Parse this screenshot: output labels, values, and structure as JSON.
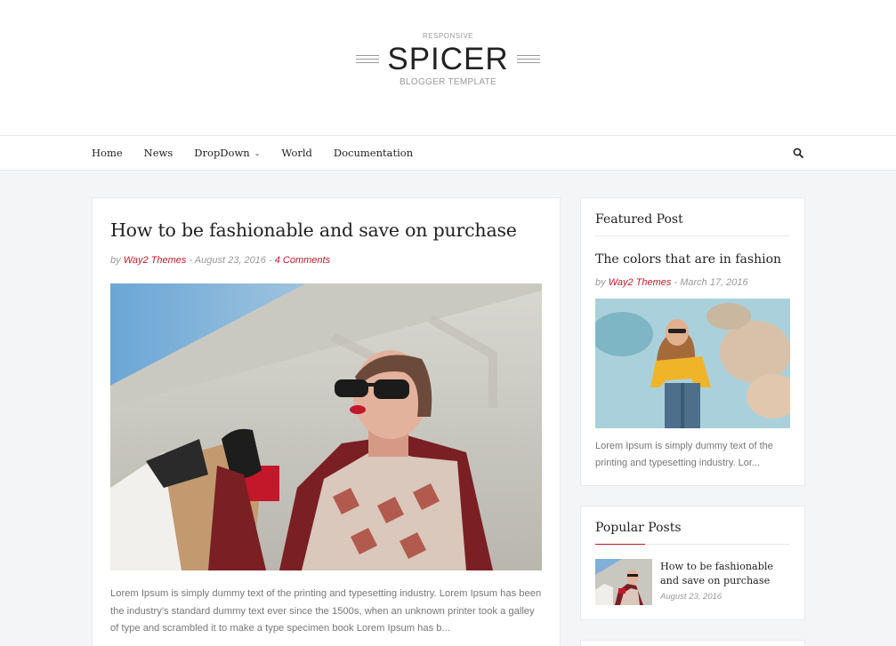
{
  "header": {
    "logo_tag": "RESPONSIVE",
    "logo_main": "SPICER",
    "logo_sub": "BLOGGER TEMPLATE"
  },
  "nav": {
    "items": [
      {
        "label": "Home"
      },
      {
        "label": "News"
      },
      {
        "label": "DropDown"
      },
      {
        "label": "World"
      },
      {
        "label": "Documentation"
      }
    ],
    "search_icon": "search-icon"
  },
  "post": {
    "title": "How to be fashionable and save on purchase",
    "by": "by",
    "author": "Way2 Themes",
    "sep1": "-",
    "date": "August 23, 2016",
    "sep2": "-",
    "comments": "4 Comments",
    "excerpt": "Lorem Ipsum is simply dummy text of the printing and typesetting industry. Lorem Ipsum has been the industry's standard dummy text ever since the 1500s, when an unknown printer took a galley of type and scrambled it to make a type specimen book Lorem Ipsum has b..."
  },
  "featured": {
    "widget_title": "Featured Post",
    "title": "The colors that are in fashion",
    "by": "by",
    "author": "Way2 Themes",
    "sep": "-",
    "date": "March 17, 2016",
    "excerpt": "Lorem Ipsum is simply dummy text of the printing and typesetting industry. Lor..."
  },
  "popular": {
    "widget_title": "Popular Posts",
    "items": [
      {
        "title": "How to be fashionable and save on purchase",
        "date": "August 23, 2016"
      }
    ]
  },
  "colors": {
    "accent": "#c0192b",
    "background": "#f4f5f7"
  }
}
